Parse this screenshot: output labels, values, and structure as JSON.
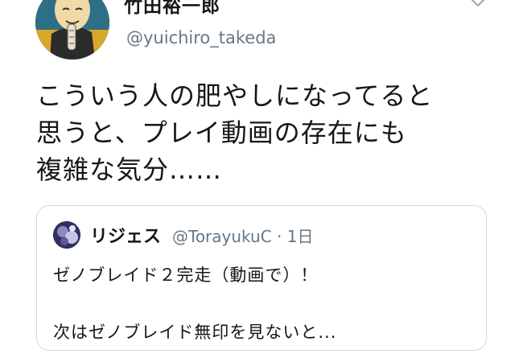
{
  "tweet": {
    "author": {
      "display_name": "竹田裕一郎",
      "handle": "@yuichiro_takeda",
      "avatar_icon": "avatar-illustration"
    },
    "menu_icon": "chevron-down-icon",
    "text_lines": [
      "こういう人の肥やしになってると",
      "思うと、プレイ動画の存在にも",
      "複雑な気分……"
    ]
  },
  "quoted_tweet": {
    "display_name": "リジェス",
    "handle_time": "@TorayukuC · 1日",
    "line1": "ゼノブレイド２完走（動画で）！",
    "line2": "次はゼノブレイド無印を見ないと..."
  },
  "colors": {
    "text": "#14171a",
    "secondary": "#657786",
    "border": "#cfd9de"
  }
}
